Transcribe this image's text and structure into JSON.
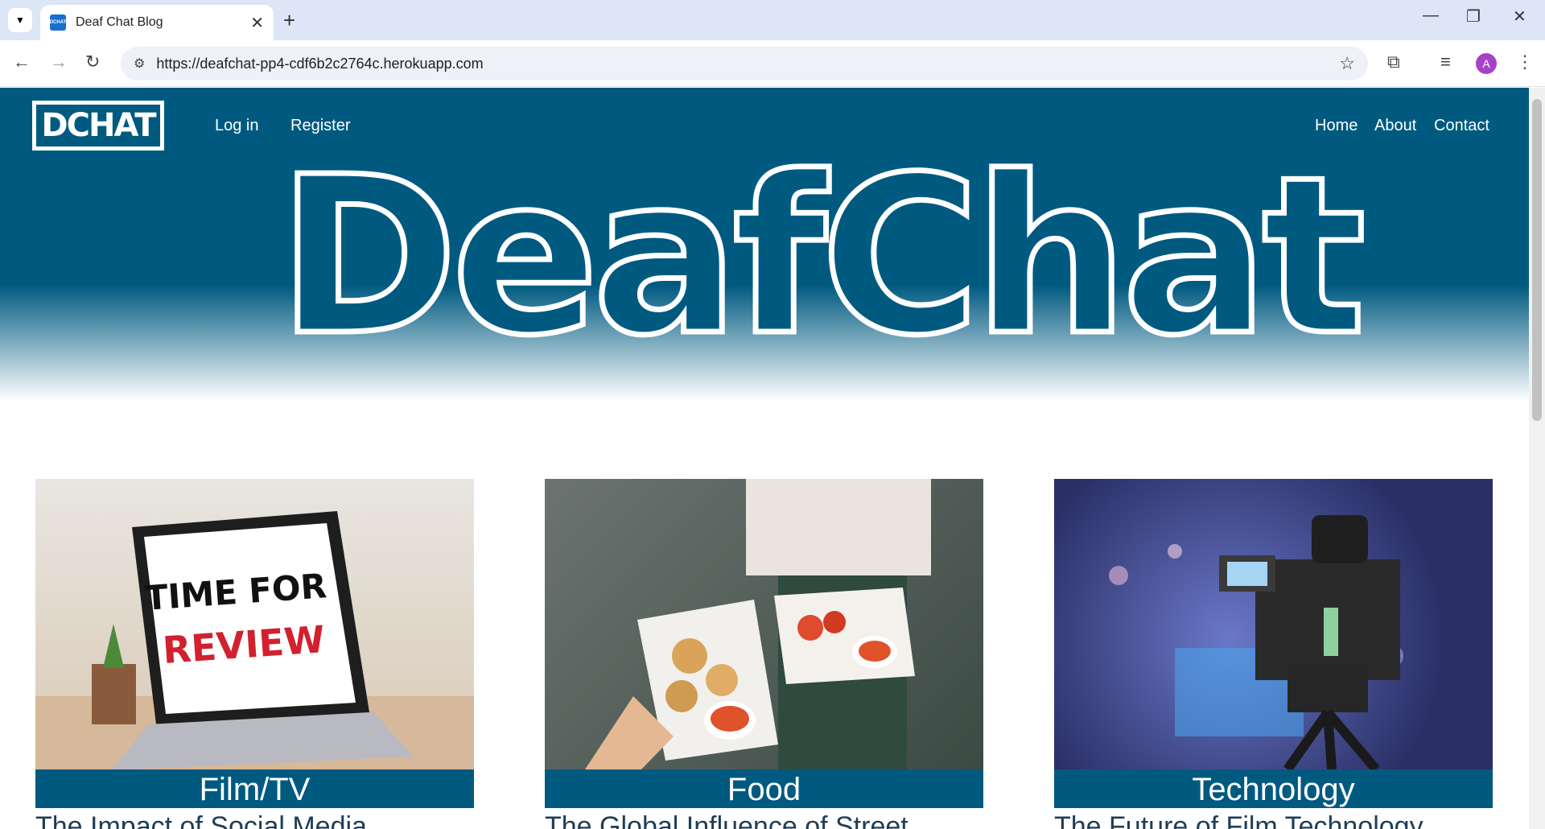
{
  "browser": {
    "tab_title": "Deaf Chat Blog",
    "url": "https://deafchat-pp4-cdf6b2c2764c.herokuapp.com",
    "avatar_letter": "A",
    "favicon_text": "DCHAT"
  },
  "site": {
    "logo_text": "DCHAT",
    "nav_left": [
      "Log in",
      "Register"
    ],
    "nav_right": [
      "Home",
      "About",
      "Contact"
    ],
    "hero_title": "DeafChat",
    "brand_color": "#005a80"
  },
  "cards": [
    {
      "category": "Film/TV",
      "headline": "The Impact of Social Media",
      "image_text_1": "TIME FOR",
      "image_text_2": "REVIEW"
    },
    {
      "category": "Food",
      "headline": "The Global Influence of Street"
    },
    {
      "category": "Technology",
      "headline": "The Future of Film Technology"
    }
  ]
}
